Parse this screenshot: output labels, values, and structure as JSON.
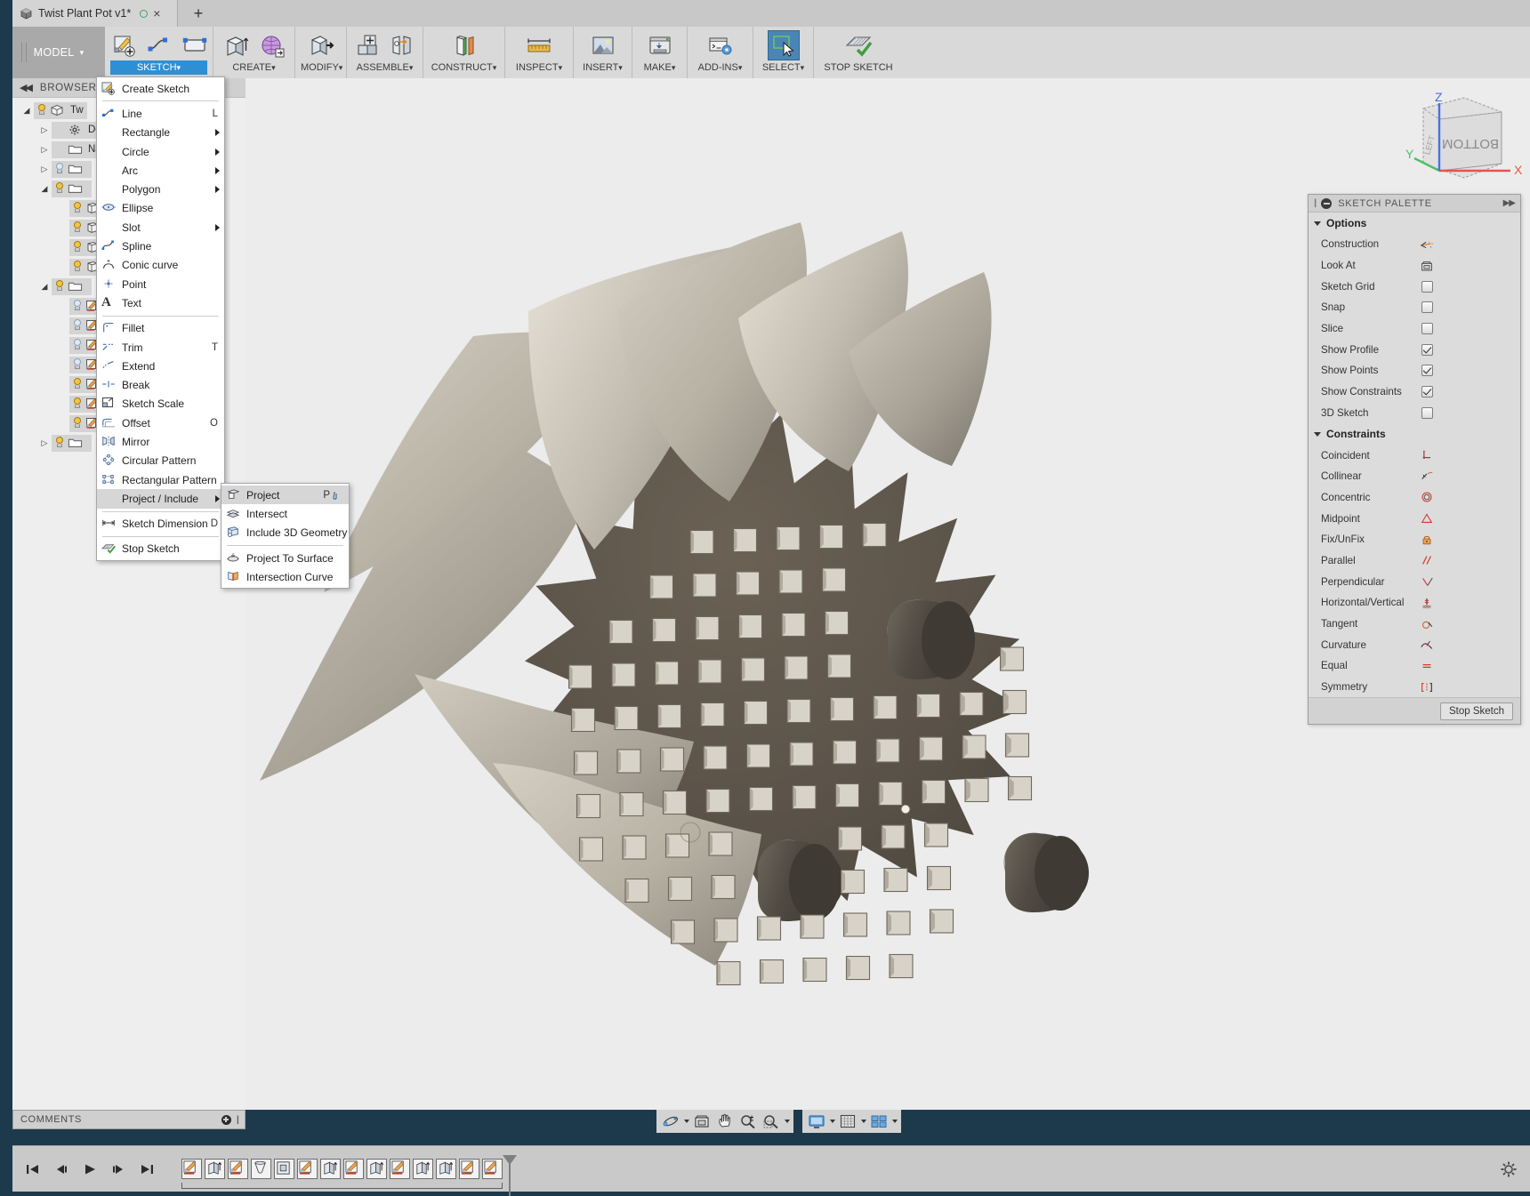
{
  "window": {
    "document_tab": {
      "title": "Twist Plant Pot v1*",
      "icon": "cube-icon",
      "saved_dot": "unsaved-indicator",
      "close": "×"
    },
    "new_tab_label": "+"
  },
  "ribbon": {
    "workspace_selector": {
      "label": "MODEL",
      "caret": "▾"
    },
    "groups": [
      {
        "name": "sketch",
        "label": "SKETCH",
        "active": true,
        "tools": [
          "create-sketch",
          "line",
          "rectangle"
        ]
      },
      {
        "name": "create",
        "label": "CREATE",
        "active": false,
        "tools": [
          "extrude",
          "create-form"
        ]
      },
      {
        "name": "modify",
        "label": "MODIFY",
        "active": false,
        "tools": [
          "press-pull"
        ]
      },
      {
        "name": "assemble",
        "label": "ASSEMBLE",
        "active": false,
        "tools": [
          "new-component",
          "joint"
        ]
      },
      {
        "name": "construct",
        "label": "CONSTRUCT",
        "active": false,
        "tools": [
          "offset-plane"
        ]
      },
      {
        "name": "inspect",
        "label": "INSPECT",
        "active": false,
        "tools": [
          "measure"
        ]
      },
      {
        "name": "insert",
        "label": "INSERT",
        "active": false,
        "tools": [
          "insert-canvas"
        ]
      },
      {
        "name": "make",
        "label": "MAKE",
        "active": false,
        "tools": [
          "3d-print"
        ]
      },
      {
        "name": "addins",
        "label": "ADD-INS",
        "active": false,
        "tools": [
          "scripts-addins"
        ]
      },
      {
        "name": "select",
        "label": "SELECT",
        "active": false,
        "tools": [
          "select"
        ],
        "selected": true
      },
      {
        "name": "stopsketch",
        "label": "STOP SKETCH",
        "active": false,
        "tools": [
          "stop-sketch"
        ],
        "no_caret": true
      }
    ],
    "caret": "▾"
  },
  "browser": {
    "title": "BROWSER",
    "collapse": "◀◀",
    "items": [
      {
        "label": "Tw",
        "indent": 0,
        "expander": "down",
        "bulb": "on",
        "icon": "component-icon",
        "selected": true
      },
      {
        "label": "Doc",
        "indent": 1,
        "expander": "right",
        "bulb": "none",
        "icon": "gear-icon"
      },
      {
        "label": "Nam",
        "indent": 1,
        "expander": "right",
        "bulb": "none",
        "icon": "folder-icon"
      },
      {
        "label": "",
        "indent": 1,
        "expander": "right",
        "bulb": "off",
        "icon": "folder-icon"
      },
      {
        "label": "",
        "indent": 1,
        "expander": "down",
        "bulb": "on",
        "icon": "folder-icon"
      },
      {
        "label": "",
        "indent": 2,
        "expander": "none",
        "bulb": "on",
        "icon": "body-icon"
      },
      {
        "label": "",
        "indent": 2,
        "expander": "none",
        "bulb": "on",
        "icon": "body-icon"
      },
      {
        "label": "",
        "indent": 2,
        "expander": "none",
        "bulb": "on",
        "icon": "body-icon"
      },
      {
        "label": "",
        "indent": 2,
        "expander": "none",
        "bulb": "on",
        "icon": "body-icon"
      },
      {
        "label": "",
        "indent": 1,
        "expander": "down",
        "bulb": "on",
        "icon": "folder-icon"
      },
      {
        "label": "",
        "indent": 2,
        "expander": "none",
        "bulb": "off",
        "icon": "sketch-icon"
      },
      {
        "label": "",
        "indent": 2,
        "expander": "none",
        "bulb": "off",
        "icon": "sketch-icon"
      },
      {
        "label": "",
        "indent": 2,
        "expander": "none",
        "bulb": "off",
        "icon": "sketch-icon"
      },
      {
        "label": "",
        "indent": 2,
        "expander": "none",
        "bulb": "off",
        "icon": "sketch-icon"
      },
      {
        "label": "",
        "indent": 2,
        "expander": "none",
        "bulb": "on",
        "icon": "sketch-icon"
      },
      {
        "label": "",
        "indent": 2,
        "expander": "none",
        "bulb": "on",
        "icon": "sketch-icon"
      },
      {
        "label": "",
        "indent": 2,
        "expander": "none",
        "bulb": "on",
        "icon": "sketch-icon"
      },
      {
        "label": "",
        "indent": 1,
        "expander": "right",
        "bulb": "on",
        "icon": "folder-icon"
      }
    ]
  },
  "sketch_menu": {
    "items": [
      {
        "label": "Create Sketch",
        "icon": "create-sketch-icon",
        "shortcut": "",
        "submenu": false,
        "sep_after": true
      },
      {
        "label": "Line",
        "icon": "line-icon",
        "shortcut": "L",
        "submenu": false
      },
      {
        "label": "Rectangle",
        "icon": "",
        "shortcut": "",
        "submenu": true
      },
      {
        "label": "Circle",
        "icon": "",
        "shortcut": "",
        "submenu": true
      },
      {
        "label": "Arc",
        "icon": "",
        "shortcut": "",
        "submenu": true
      },
      {
        "label": "Polygon",
        "icon": "",
        "shortcut": "",
        "submenu": true
      },
      {
        "label": "Ellipse",
        "icon": "ellipse-icon",
        "shortcut": "",
        "submenu": false
      },
      {
        "label": "Slot",
        "icon": "",
        "shortcut": "",
        "submenu": true
      },
      {
        "label": "Spline",
        "icon": "spline-icon",
        "shortcut": "",
        "submenu": false
      },
      {
        "label": "Conic curve",
        "icon": "conic-curve-icon",
        "shortcut": "",
        "submenu": false
      },
      {
        "label": "Point",
        "icon": "point-icon",
        "shortcut": "",
        "submenu": false
      },
      {
        "label": "Text",
        "icon": "text-icon",
        "shortcut": "",
        "submenu": false,
        "sep_after": true
      },
      {
        "label": "Fillet",
        "icon": "fillet-icon",
        "shortcut": "",
        "submenu": false
      },
      {
        "label": "Trim",
        "icon": "trim-icon",
        "shortcut": "T",
        "submenu": false
      },
      {
        "label": "Extend",
        "icon": "extend-icon",
        "shortcut": "",
        "submenu": false
      },
      {
        "label": "Break",
        "icon": "break-icon",
        "shortcut": "",
        "submenu": false
      },
      {
        "label": "Sketch Scale",
        "icon": "sketch-scale-icon",
        "shortcut": "",
        "submenu": false
      },
      {
        "label": "Offset",
        "icon": "offset-icon",
        "shortcut": "O",
        "submenu": false
      },
      {
        "label": "Mirror",
        "icon": "mirror-icon",
        "shortcut": "",
        "submenu": false
      },
      {
        "label": "Circular Pattern",
        "icon": "circular-pattern-icon",
        "shortcut": "",
        "submenu": false
      },
      {
        "label": "Rectangular Pattern",
        "icon": "rectangular-pattern-icon",
        "shortcut": "",
        "submenu": false
      },
      {
        "label": "Project / Include",
        "icon": "",
        "shortcut": "",
        "submenu": true,
        "hovered": true,
        "sep_after": true
      },
      {
        "label": "Sketch Dimension",
        "icon": "sketch-dimension-icon",
        "shortcut": "D",
        "submenu": false,
        "sep_after": true
      },
      {
        "label": "Stop Sketch",
        "icon": "stop-sketch-icon",
        "shortcut": "",
        "submenu": false
      }
    ]
  },
  "project_submenu": {
    "items": [
      {
        "label": "Project",
        "icon": "project-icon",
        "shortcut": "P",
        "hovered": true,
        "has_pin": true
      },
      {
        "label": "Intersect",
        "icon": "intersect-icon",
        "shortcut": ""
      },
      {
        "label": "Include 3D Geometry",
        "icon": "include-3d-geometry-icon",
        "shortcut": "",
        "sep_after": true
      },
      {
        "label": "Project To Surface",
        "icon": "project-to-surface-icon",
        "shortcut": ""
      },
      {
        "label": "Intersection Curve",
        "icon": "intersection-curve-icon",
        "shortcut": ""
      }
    ]
  },
  "sketch_palette": {
    "title": "SKETCH PALETTE",
    "minimize_icon": "minimize-icon",
    "grip_icon": "grip-icon",
    "expand_icon": "expand-right-icon",
    "sections": [
      {
        "name": "Options",
        "rows": [
          {
            "label": "Construction",
            "control": "icon",
            "icon": "construction-icon"
          },
          {
            "label": "Look At",
            "control": "icon",
            "icon": "look-at-icon"
          },
          {
            "label": "Sketch Grid",
            "control": "checkbox",
            "checked": false
          },
          {
            "label": "Snap",
            "control": "checkbox",
            "checked": false
          },
          {
            "label": "Slice",
            "control": "checkbox",
            "checked": false
          },
          {
            "label": "Show Profile",
            "control": "checkbox",
            "checked": true
          },
          {
            "label": "Show Points",
            "control": "checkbox",
            "checked": true
          },
          {
            "label": "Show Constraints",
            "control": "checkbox",
            "checked": true
          },
          {
            "label": "3D Sketch",
            "control": "checkbox",
            "checked": false
          }
        ]
      },
      {
        "name": "Constraints",
        "rows": [
          {
            "label": "Coincident",
            "control": "icon",
            "icon": "coincident-constraint-icon"
          },
          {
            "label": "Collinear",
            "control": "icon",
            "icon": "collinear-constraint-icon"
          },
          {
            "label": "Concentric",
            "control": "icon",
            "icon": "concentric-constraint-icon"
          },
          {
            "label": "Midpoint",
            "control": "icon",
            "icon": "midpoint-constraint-icon"
          },
          {
            "label": "Fix/UnFix",
            "control": "icon",
            "icon": "fix-unfix-constraint-icon"
          },
          {
            "label": "Parallel",
            "control": "icon",
            "icon": "parallel-constraint-icon"
          },
          {
            "label": "Perpendicular",
            "control": "icon",
            "icon": "perpendicular-constraint-icon"
          },
          {
            "label": "Horizontal/Vertical",
            "control": "icon",
            "icon": "horizontal-vertical-constraint-icon"
          },
          {
            "label": "Tangent",
            "control": "icon",
            "icon": "tangent-constraint-icon"
          },
          {
            "label": "Curvature",
            "control": "icon",
            "icon": "curvature-constraint-icon"
          },
          {
            "label": "Equal",
            "control": "icon",
            "icon": "equal-constraint-icon"
          },
          {
            "label": "Symmetry",
            "control": "icon",
            "icon": "symmetry-constraint-icon"
          }
        ]
      }
    ],
    "footer_button": "Stop Sketch"
  },
  "comments_panel": {
    "title": "COMMENTS",
    "add_icon": "add-comment-icon",
    "grip_icon": "grip-icon"
  },
  "nav_bar": {
    "groups": [
      {
        "buttons": [
          {
            "name": "orbit-icon",
            "caret": true
          },
          {
            "name": "look-at-icon",
            "caret": false
          },
          {
            "name": "pan-icon",
            "caret": false
          },
          {
            "name": "zoom-icon",
            "caret": false
          },
          {
            "name": "zoom-window-icon",
            "caret": true
          }
        ]
      },
      {
        "buttons": [
          {
            "name": "display-settings-icon",
            "caret": true
          },
          {
            "name": "grid-snaps-icon",
            "caret": true
          },
          {
            "name": "viewports-icon",
            "caret": true
          }
        ]
      }
    ]
  },
  "timeline": {
    "playback": [
      "go-to-beginning-icon",
      "step-back-icon",
      "play-icon",
      "step-forward-icon",
      "go-to-end-icon"
    ],
    "features": [
      "sketch-icon",
      "extrude-icon",
      "sketch-icon",
      "loft-icon",
      "shell-icon",
      "sketch-icon",
      "extrude-icon",
      "sketch-icon",
      "extrude-icon",
      "sketch-icon",
      "extrude-icon",
      "extrude-icon",
      "sketch-icon",
      "sketch-icon"
    ],
    "settings_icon": "timeline-settings-icon"
  },
  "viewcube": {
    "face_label": "BOTTOM",
    "side_label": "LEFT",
    "axes": [
      {
        "name": "X",
        "color": "#e8524a"
      },
      {
        "name": "Y",
        "color": "#4fbf63"
      },
      {
        "name": "Z",
        "color": "#4a6fe8"
      }
    ]
  },
  "model": {
    "name": "twist-plant-pot-bottom-view",
    "body_color": "#5c5349",
    "petal_light": "#ccc7bb",
    "petal_mid": "#b4aea2",
    "petal_dark": "#8e897e"
  },
  "colors": {
    "accent_blue": "#2f8fd4",
    "chrome_gray": "#d9d9d9",
    "panel_gray": "#dcdcdc",
    "viewport_bg": "#ececec",
    "desktop_blue": "#1d3a4d"
  }
}
